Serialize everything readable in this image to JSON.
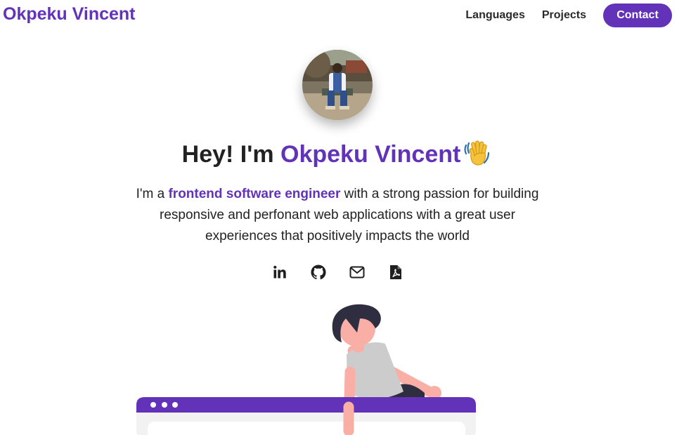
{
  "header": {
    "brand": "Okpeku Vincent",
    "nav": [
      {
        "label": "Languages"
      },
      {
        "label": "Projects"
      }
    ],
    "contact_label": "Contact"
  },
  "hero": {
    "title_prefix": "Hey! I'm ",
    "title_name": "Okpeku Vincent",
    "wave_icon": "waving-hand-icon",
    "intro_prefix": "I'm a ",
    "intro_highlight": "frontend software engineer",
    "intro_rest": " with a strong passion for building responsive and perfonant web applications with a great user experiences that positively impacts the world"
  },
  "social": [
    {
      "icon": "linkedin-icon"
    },
    {
      "icon": "github-icon"
    },
    {
      "icon": "email-icon"
    },
    {
      "icon": "pdf-resume-icon"
    }
  ],
  "colors": {
    "accent": "#6233b8",
    "text": "#222222",
    "background": "#ffffff"
  }
}
